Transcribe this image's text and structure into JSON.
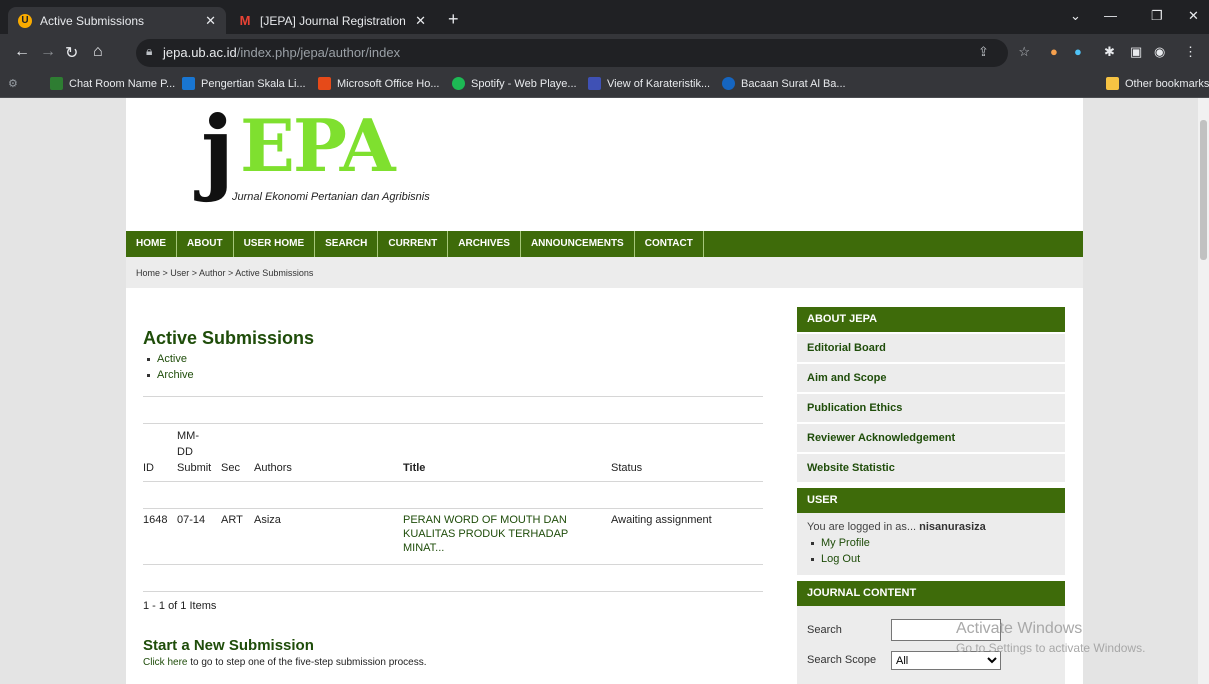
{
  "browser": {
    "tabs": [
      {
        "title": "Active Submissions",
        "active": true,
        "icon": "ub-logo-icon"
      },
      {
        "title": "[JEPA] Journal Registration - nisa",
        "active": false,
        "icon": "gmail-icon"
      }
    ],
    "url_domain": "jepa.ub.ac.id",
    "url_path": "/index.php/jepa/author/index",
    "bookmarks": [
      {
        "label": "Chat Room Name P...",
        "color": "#2e7d32"
      },
      {
        "label": "Pengertian Skala Li...",
        "color": "#1976d2"
      },
      {
        "label": "Microsoft Office Ho...",
        "color": "#e64a19"
      },
      {
        "label": "Spotify - Web Playe...",
        "color": "#1db954"
      },
      {
        "label": "View of Karateristik...",
        "color": "#3f51b5"
      },
      {
        "label": "Bacaan Surat Al Ba...",
        "color": "#1565c0"
      }
    ],
    "other_bookmarks": "Other bookmarks"
  },
  "site": {
    "logo_j": "j",
    "logo_epa": "EPA",
    "logo_subtitle": "Jurnal Ekonomi Pertanian dan Agribisnis",
    "menu": [
      "HOME",
      "ABOUT",
      "USER HOME",
      "SEARCH",
      "CURRENT",
      "ARCHIVES",
      "ANNOUNCEMENTS",
      "CONTACT"
    ],
    "breadcrumb": "Home > User > Author > Active Submissions"
  },
  "main": {
    "title": "Active Submissions",
    "filters": [
      "Active",
      "Archive"
    ],
    "columns": {
      "id": "ID",
      "date": [
        "MM-",
        "DD",
        "Submit"
      ],
      "sec": "Sec",
      "authors": "Authors",
      "title": "Title",
      "status": "Status"
    },
    "rows": [
      {
        "id": "1648",
        "date": "07-14",
        "sec": "ART",
        "authors": "Asiza",
        "title": [
          "PERAN WORD OF MOUTH DAN",
          "KUALITAS PRODUK TERHADAP",
          "MINAT..."
        ],
        "status": "Awaiting assignment"
      }
    ],
    "pagination": "1 - 1 of 1 Items",
    "new_submission_title": "Start a New Submission",
    "new_submission_link": "Click here",
    "new_submission_text": " to go to step one of the five-step submission process."
  },
  "sidebar": {
    "about_head": "ABOUT JEPA",
    "about_links": [
      "Editorial Board",
      "Aim and Scope",
      "Publication Ethics",
      "Reviewer Acknowledgement",
      "Website Statistic"
    ],
    "user_head": "USER",
    "logged_in_prefix": "You are logged in as...",
    "username": "nisanurasiza",
    "user_links": [
      "My Profile",
      "Log Out"
    ],
    "content_head": "JOURNAL CONTENT",
    "search_label": "Search",
    "scope_label": "Search Scope",
    "scope_value": "All"
  },
  "watermark": {
    "line1": "Activate Windows",
    "line2": "Go to Settings to activate Windows."
  }
}
